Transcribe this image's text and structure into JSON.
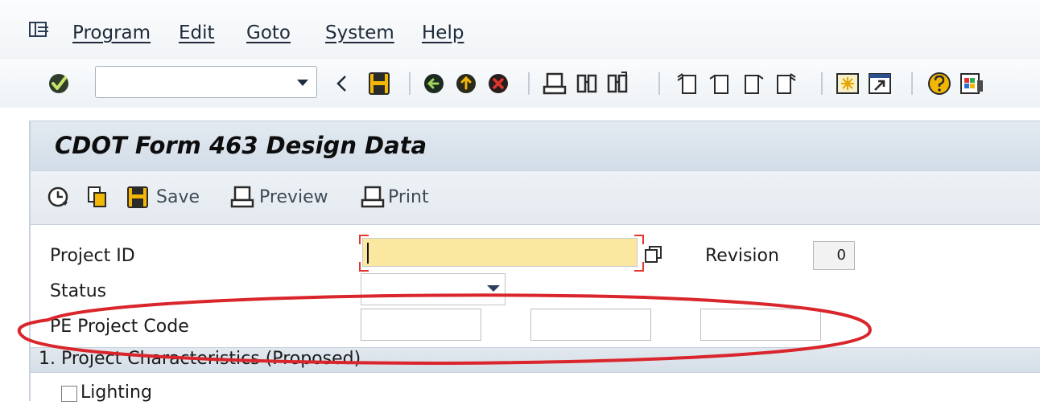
{
  "menu": {
    "items": [
      {
        "label": "Program"
      },
      {
        "label": "Edit"
      },
      {
        "label": "Goto"
      },
      {
        "label": "System"
      },
      {
        "label": "Help"
      }
    ]
  },
  "toolbar": {
    "command_field": {
      "value": ""
    },
    "icons": [
      "enter-icon",
      "back-icon",
      "save-icon",
      "back-circle-icon",
      "exit-icon",
      "cancel-icon",
      "print-icon",
      "find-icon",
      "find-next-icon",
      "first-page-icon",
      "previous-page-icon",
      "next-page-icon",
      "last-page-icon",
      "new-session-icon",
      "shortcut-icon",
      "help-icon",
      "customize-layout-icon"
    ]
  },
  "title": "CDOT Form 463 Design Data",
  "app_toolbar": {
    "save_label": "Save",
    "preview_label": "Preview",
    "print_label": "Print",
    "icons": [
      "execute-icon",
      "copy-icon",
      "save-icon",
      "preview-icon",
      "print-icon"
    ]
  },
  "form": {
    "project_id": {
      "label": "Project ID",
      "value": ""
    },
    "revision": {
      "label": "Revision",
      "value": "0"
    },
    "status": {
      "label": "Status",
      "value": ""
    },
    "pe_project_code": {
      "label": "PE Project Code",
      "values": [
        "",
        "",
        ""
      ]
    }
  },
  "section": {
    "header": "1. Project Characteristics (Proposed)",
    "checkbox_label": "Lighting",
    "checkbox_checked": false
  },
  "colors": {
    "input_highlight": "#fbe8a0",
    "required_bracket": "#e2362f",
    "annotation_ellipse": "#d9252b",
    "title_bar": "#d8e2ec"
  }
}
